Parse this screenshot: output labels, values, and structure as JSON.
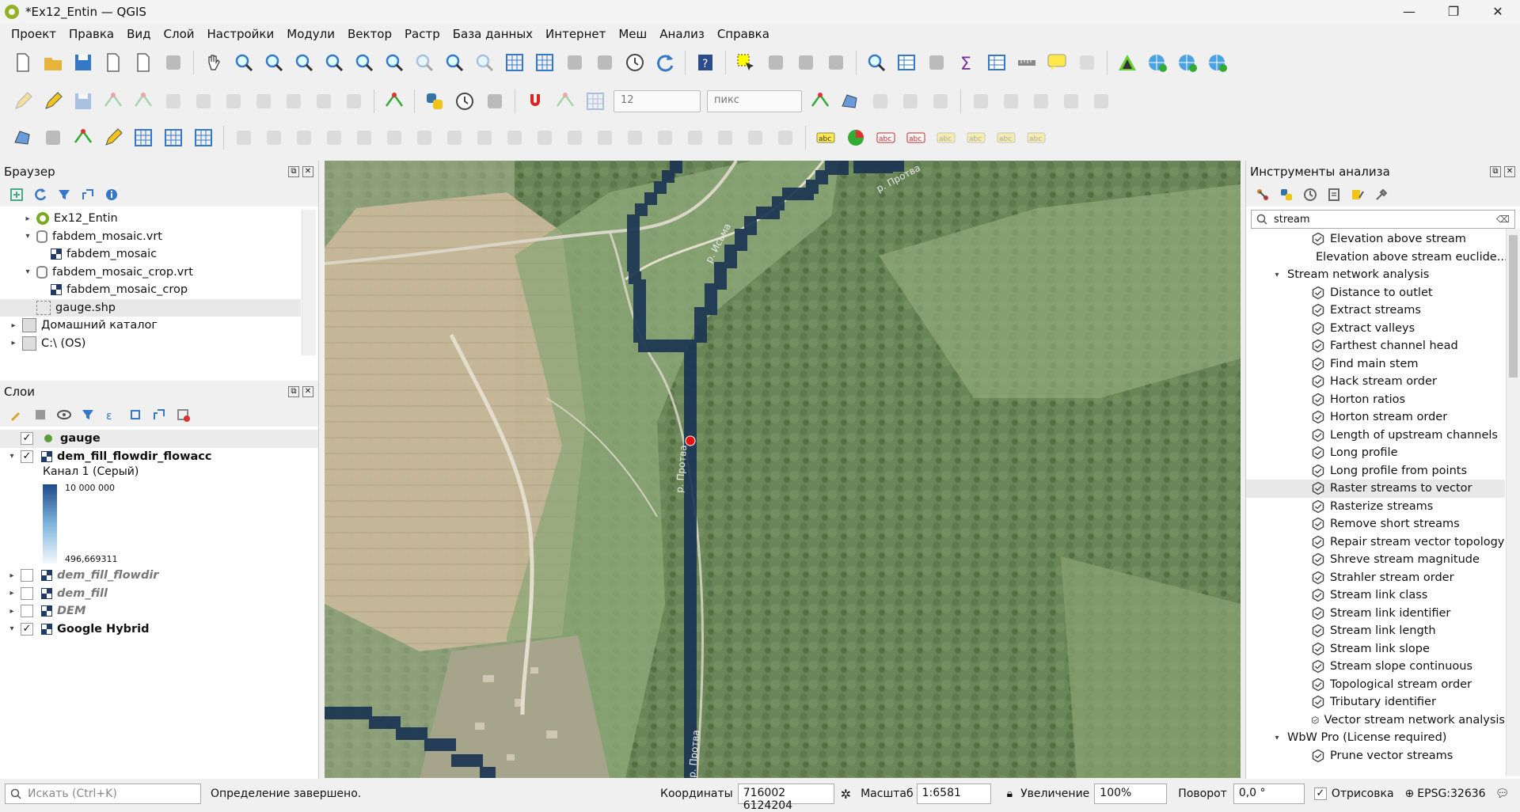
{
  "window": {
    "title": "*Ex12_Entin — QGIS",
    "minimize": "—",
    "maximize": "❐",
    "close": "✕"
  },
  "menu": [
    "Проект",
    "Правка",
    "Вид",
    "Слой",
    "Настройки",
    "Модули",
    "Вектор",
    "Растр",
    "База данных",
    "Интернет",
    "Меш",
    "Анализ",
    "Справка"
  ],
  "toolbar2": {
    "snap_value": "12",
    "unit": "пикс"
  },
  "browser": {
    "title": "Браузер",
    "items": [
      {
        "label": "Ex12_Entin",
        "indent": 1,
        "icon": "qgis-project-icon",
        "expand": "▸"
      },
      {
        "label": "fabdem_mosaic.vrt",
        "indent": 1,
        "icon": "database-icon",
        "expand": "▾"
      },
      {
        "label": "fabdem_mosaic",
        "indent": 2,
        "icon": "raster-icon",
        "expand": ""
      },
      {
        "label": "fabdem_mosaic_crop.vrt",
        "indent": 1,
        "icon": "database-icon",
        "expand": "▾"
      },
      {
        "label": "fabdem_mosaic_crop",
        "indent": 2,
        "icon": "raster-icon",
        "expand": ""
      },
      {
        "label": "gauge.shp",
        "indent": 1,
        "icon": "shapefile-icon",
        "expand": ""
      },
      {
        "label": "Домашний каталог",
        "indent": 0,
        "icon": "folder-icon",
        "expand": "▸"
      },
      {
        "label": "C:\\ (OS)",
        "indent": 0,
        "icon": "folder-icon",
        "expand": "▸"
      }
    ]
  },
  "layers": {
    "title": "Слои",
    "items": [
      {
        "label": "gauge",
        "checked": true,
        "bold": true,
        "italic": false,
        "icon": "point-icon",
        "expand": ""
      },
      {
        "label": "dem_fill_flowdir_flowacc",
        "checked": true,
        "bold": true,
        "italic": false,
        "icon": "raster-icon",
        "expand": "▾"
      },
      {
        "label": "dem_fill_flowdir",
        "checked": false,
        "bold": true,
        "italic": true,
        "icon": "raster-icon",
        "expand": "▸"
      },
      {
        "label": "dem_fill",
        "checked": false,
        "bold": true,
        "italic": true,
        "icon": "raster-icon",
        "expand": "▸"
      },
      {
        "label": "DEM",
        "checked": false,
        "bold": true,
        "italic": true,
        "icon": "raster-icon",
        "expand": "▸"
      },
      {
        "label": "Google Hybrid",
        "checked": true,
        "bold": true,
        "italic": false,
        "icon": "raster-icon",
        "expand": "▾"
      }
    ],
    "legend": {
      "band": "Канал 1 (Серый)",
      "max": "10 000 000",
      "min": "496,669311"
    }
  },
  "map": {
    "labels": [
      "р. Исьма",
      "р. Протва",
      "р. Протва",
      "р. Протва"
    ]
  },
  "processing": {
    "title": "Инструменты анализа",
    "search": "stream",
    "items": [
      {
        "label": "Elevation above stream",
        "group": false
      },
      {
        "label": "Elevation above stream euclide...",
        "group": false
      },
      {
        "label": "Stream network analysis",
        "group": true
      },
      {
        "label": "Distance to outlet",
        "group": false
      },
      {
        "label": "Extract streams",
        "group": false
      },
      {
        "label": "Extract valleys",
        "group": false
      },
      {
        "label": "Farthest channel head",
        "group": false
      },
      {
        "label": "Find main stem",
        "group": false
      },
      {
        "label": "Hack stream order",
        "group": false
      },
      {
        "label": "Horton ratios",
        "group": false
      },
      {
        "label": "Horton stream order",
        "group": false
      },
      {
        "label": "Length of upstream channels",
        "group": false
      },
      {
        "label": "Long profile",
        "group": false
      },
      {
        "label": "Long profile from points",
        "group": false
      },
      {
        "label": "Raster streams to vector",
        "group": false,
        "selected": true
      },
      {
        "label": "Rasterize streams",
        "group": false
      },
      {
        "label": "Remove short streams",
        "group": false
      },
      {
        "label": "Repair stream vector topology",
        "group": false
      },
      {
        "label": "Shreve stream magnitude",
        "group": false
      },
      {
        "label": "Strahler stream order",
        "group": false
      },
      {
        "label": "Stream link class",
        "group": false
      },
      {
        "label": "Stream link identifier",
        "group": false
      },
      {
        "label": "Stream link length",
        "group": false
      },
      {
        "label": "Stream link slope",
        "group": false
      },
      {
        "label": "Stream slope continuous",
        "group": false
      },
      {
        "label": "Topological stream order",
        "group": false
      },
      {
        "label": "Tributary identifier",
        "group": false
      },
      {
        "label": "Vector stream network analysis",
        "group": false
      },
      {
        "label": "WbW Pro (License required)",
        "group": true
      },
      {
        "label": "Prune vector streams",
        "group": false
      }
    ]
  },
  "status": {
    "search_placeholder": "Искать (Ctrl+K)",
    "message": "Определение завершено.",
    "coord_label": "Координаты",
    "coords": "716002  6124204",
    "scale_label": "Масштаб",
    "scale": "1:6581",
    "zoom_label": "Увеличение",
    "zoom": "100%",
    "rotation_label": "Поворот",
    "rotation": "0,0 °",
    "render_label": "Отрисовка",
    "crs": "EPSG:32636"
  }
}
